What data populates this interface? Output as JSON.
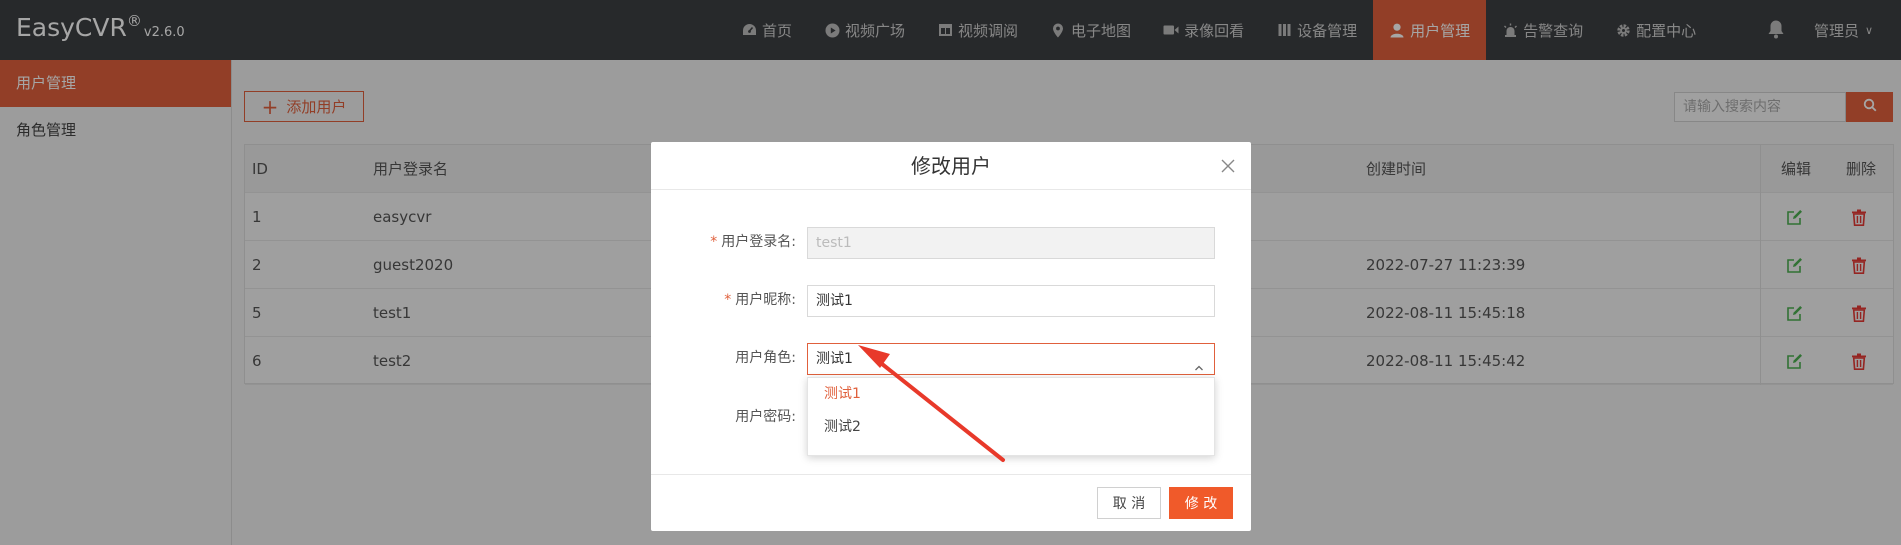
{
  "app": {
    "name": "EasyCVR",
    "reg": "®",
    "version": "v2.6.0"
  },
  "nav": {
    "items": [
      {
        "label": "首页",
        "icon": "dashboard-icon"
      },
      {
        "label": "视频广场",
        "icon": "play-circle-icon"
      },
      {
        "label": "视频调阅",
        "icon": "grid-view-icon"
      },
      {
        "label": "电子地图",
        "icon": "map-pin-icon"
      },
      {
        "label": "录像回看",
        "icon": "video-camera-icon"
      },
      {
        "label": "设备管理",
        "icon": "device-icon"
      },
      {
        "label": "用户管理",
        "icon": "user-icon",
        "active": true
      },
      {
        "label": "告警查询",
        "icon": "alarm-icon"
      },
      {
        "label": "配置中心",
        "icon": "gear-icon"
      }
    ],
    "admin_label": "管理员",
    "admin_caret": "∨"
  },
  "sidebar": {
    "items": [
      {
        "label": "用户管理",
        "active": true
      },
      {
        "label": "角色管理"
      }
    ]
  },
  "toolbar": {
    "add_label": "添加用户",
    "search_placeholder": "请输入搜索内容"
  },
  "table": {
    "columns": {
      "id": "ID",
      "login": "用户登录名",
      "created": "创建时间",
      "edit": "编辑",
      "delete": "删除"
    },
    "rows": [
      {
        "id": "1",
        "login": "easycvr",
        "created": ""
      },
      {
        "id": "2",
        "login": "guest2020",
        "created": "2022-07-27 11:23:39"
      },
      {
        "id": "5",
        "login": "test1",
        "created": "2022-08-11 15:45:18"
      },
      {
        "id": "6",
        "login": "test2",
        "created": "2022-08-11 15:45:42"
      }
    ]
  },
  "modal": {
    "title": "修改用户",
    "fields": {
      "login": {
        "label": "用户登录名:",
        "value": "test1",
        "required": true
      },
      "nickname": {
        "label": "用户昵称:",
        "value": "测试1",
        "required": true
      },
      "role": {
        "label": "用户角色:",
        "value": "测试1"
      },
      "password": {
        "label": "用户密码:"
      }
    },
    "role_options": [
      {
        "label": "测试1",
        "selected": true
      },
      {
        "label": "测试2"
      }
    ],
    "cancel_label": "取 消",
    "ok_label": "修 改"
  },
  "colors": {
    "accent": "#e0603c",
    "topbar": "#3d3f42",
    "edit": "#4caf50",
    "delete": "#e53935",
    "annotation": "#e8392a"
  }
}
